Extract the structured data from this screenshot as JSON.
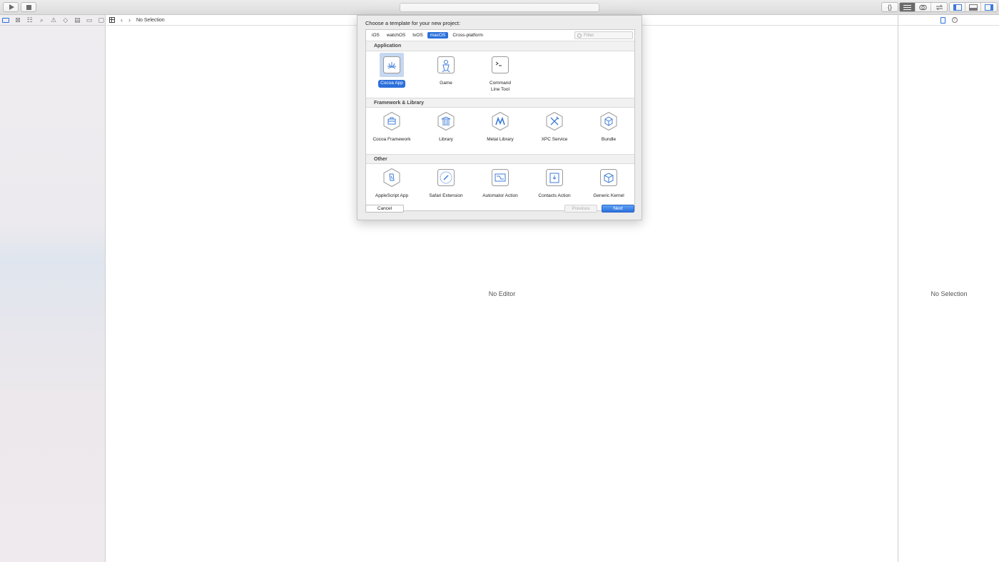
{
  "editor": {
    "empty_text": "No Editor",
    "jump_selection": "No Selection"
  },
  "inspector": {
    "empty_text": "No Selection"
  },
  "toolbar": {
    "editor_glyph": "{}"
  },
  "dialog": {
    "title": "Choose a template for your new project:",
    "tabs": [
      "iOS",
      "watchOS",
      "tvOS",
      "macOS",
      "Cross-platform"
    ],
    "active_tab": "macOS",
    "filter_placeholder": "Filter",
    "sections": [
      {
        "name": "Application",
        "templates": [
          {
            "label": "Cocoa App",
            "icon": "cocoa-app-icon",
            "selected": true
          },
          {
            "label": "Game",
            "icon": "game-icon"
          },
          {
            "label": "Command\nLine Tool",
            "icon": "terminal-icon"
          }
        ]
      },
      {
        "name": "Framework & Library",
        "templates": [
          {
            "label": "Cocoa Framework",
            "icon": "toolbox-icon"
          },
          {
            "label": "Library",
            "icon": "library-icon"
          },
          {
            "label": "Metal Library",
            "icon": "metal-icon"
          },
          {
            "label": "XPC Service",
            "icon": "tools-icon"
          },
          {
            "label": "Bundle",
            "icon": "cube-icon"
          }
        ]
      },
      {
        "name": "Other",
        "templates": [
          {
            "label": "AppleScript App",
            "icon": "script-icon"
          },
          {
            "label": "Safari Extension",
            "icon": "compass-icon"
          },
          {
            "label": "Automator Action",
            "icon": "automator-icon"
          },
          {
            "label": "Contacts Action",
            "icon": "contacts-icon"
          },
          {
            "label": "Generic Kernel",
            "icon": "kernel-cube-icon"
          }
        ]
      }
    ],
    "buttons": {
      "cancel": "Cancel",
      "previous": "Previous",
      "next": "Next"
    }
  },
  "colors": {
    "accent": "#2b6fdb",
    "icon_blue": "#3d7bd8",
    "dialog_bg": "#ececec"
  }
}
